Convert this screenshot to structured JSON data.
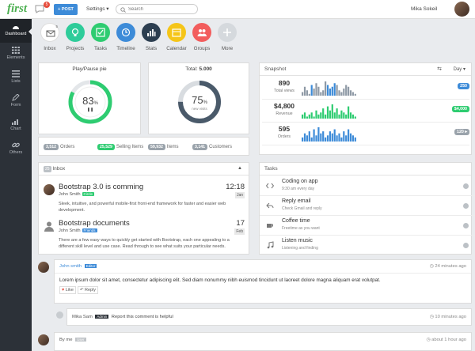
{
  "brand": "first",
  "notifications_count": "5",
  "post_label": "+ POST",
  "settings_label": "Settings ▾",
  "search": {
    "placeholder": "Search"
  },
  "user_name": "Mika Sokeil",
  "sidebar": [
    {
      "label": "Dashboard",
      "icon": "dashboard-icon"
    },
    {
      "label": "Elements",
      "icon": "grid-icon"
    },
    {
      "label": "Lists",
      "icon": "list-icon"
    },
    {
      "label": "Form",
      "icon": "pencil-icon"
    },
    {
      "label": "Chart",
      "icon": "bar-chart-icon"
    },
    {
      "label": "Others",
      "icon": "link-icon"
    }
  ],
  "apps": [
    {
      "label": "Inbox",
      "color": "#ffffff",
      "badge": "5"
    },
    {
      "label": "Projects",
      "color": "#2ecc9a"
    },
    {
      "label": "Tasks",
      "color": "#2ecc71"
    },
    {
      "label": "Timeline",
      "color": "#3d8bd8"
    },
    {
      "label": "Stats",
      "color": "#2c3e50"
    },
    {
      "label": "Calendar",
      "color": "#f5c518"
    },
    {
      "label": "Groups",
      "color": "#f25d5d"
    },
    {
      "label": "More",
      "color": "#d5d9dd"
    }
  ],
  "pie1": {
    "title": "Play/Pause pie",
    "value": 83,
    "value_label": "83",
    "unit": "%",
    "color": "#2ecc71",
    "pause_icon": "❚❚"
  },
  "pie2": {
    "title": "Total: ",
    "title_bold": "5.000",
    "value": 75,
    "value_label": "75",
    "unit": "%",
    "sub": "new visits",
    "color": "#4a5a6a"
  },
  "summary": [
    {
      "value": "3,512",
      "label": "Orders",
      "color": "#9aa3ab"
    },
    {
      "value": "25,529",
      "label": "Selling Items",
      "color": "#2ecc71"
    },
    {
      "value": "59,932",
      "label": "Items",
      "color": "#9aa3ab"
    },
    {
      "value": "3,141",
      "label": "Customers",
      "color": "#9aa3ab"
    }
  ],
  "inbox": {
    "count": "25",
    "title": "Inbox",
    "mails": [
      {
        "subject": "Bootstrap 3.0 is comming",
        "from": "John Smith",
        "tag": "Circle",
        "tag_color": "#2ecc71",
        "body": "Sleek, intuitive, and powerful mobile-first front-end framework for faster and easier web development.",
        "time": "12:18",
        "day": "Jan"
      },
      {
        "subject": "Bootstrap documents",
        "from": "John Smith",
        "tag": "Friends",
        "tag_color": "#3d8bd8",
        "body": "There are a few easy ways to quickly get started with Bootstrap, each one appealing to a different skill level and use case. Read through to see what suits your particular needs.",
        "time": "17",
        "day": "Feb"
      }
    ]
  },
  "snapshot": {
    "title": "Snapshot",
    "range": "Day ▾",
    "rows": [
      {
        "value": "890",
        "label": "Total views",
        "badge": "250",
        "badge_color": "#3d8bd8",
        "bar_color": "#8f9aa6",
        "bars": [
          2,
          5,
          3,
          1,
          6,
          4,
          7,
          5,
          2,
          3,
          8,
          6,
          4,
          5,
          7,
          6,
          3,
          2,
          4,
          6,
          5,
          3,
          2,
          1
        ],
        "highlight": [
          4,
          11,
          12,
          13,
          14
        ],
        "highlight_color": "#3d8bd8"
      },
      {
        "value": "$4,800",
        "label": "Revenue",
        "badge": "$4,000",
        "badge_color": "#2ecc71",
        "bar_color": "#2ecc71",
        "bars": [
          2,
          3,
          1,
          2,
          3,
          1,
          4,
          2,
          3,
          5,
          2,
          6,
          4,
          7,
          3,
          5,
          2,
          4,
          3,
          2,
          6,
          3,
          2,
          1
        ],
        "highlight": [],
        "highlight_color": "#2ecc71"
      },
      {
        "value": "595",
        "label": "Orders",
        "badge": "120 ▸",
        "badge_color": "#9aa3ab",
        "bar_color": "#3d8bd8",
        "bars": [
          2,
          4,
          3,
          5,
          2,
          6,
          3,
          7,
          4,
          5,
          2,
          3,
          5,
          4,
          6,
          3,
          4,
          2,
          5,
          3,
          6,
          4,
          3,
          2
        ],
        "highlight": [],
        "highlight_color": "#3d8bd8"
      }
    ]
  },
  "tasks": {
    "title": "Tasks",
    "items": [
      {
        "title": "Coding on app",
        "sub": "9:30 am every day",
        "icon": "code-icon"
      },
      {
        "title": "Reply email",
        "sub": "Check Gmail and reply",
        "icon": "reply-icon"
      },
      {
        "title": "Coffee time",
        "sub": "Freetime as you want",
        "icon": "coffee-icon"
      },
      {
        "title": "Listen music",
        "sub": "Listening and finding",
        "icon": "music-icon"
      }
    ]
  },
  "comments": [
    {
      "author": "John smith",
      "role": "Editor",
      "role_color": "#3d8bd8",
      "time": "24 minutes ago",
      "text": "Lorem ipsum dolor sit amet, consectetur adipiscing elit. Sed diam nonummy nibh euismod tincidunt ut laoreet dolore magna aliquam erat volutpat.",
      "like": "Like",
      "reply": "Reply"
    },
    {
      "author": "Mika Sam",
      "role": "Admin",
      "role_color": "#2c3138",
      "time": "10 minutes ago",
      "text": "Report this comment is helpful"
    },
    {
      "author": "By me",
      "role": "User",
      "role_color": "#c0c4c8",
      "time": "about 1 hour ago"
    }
  ]
}
